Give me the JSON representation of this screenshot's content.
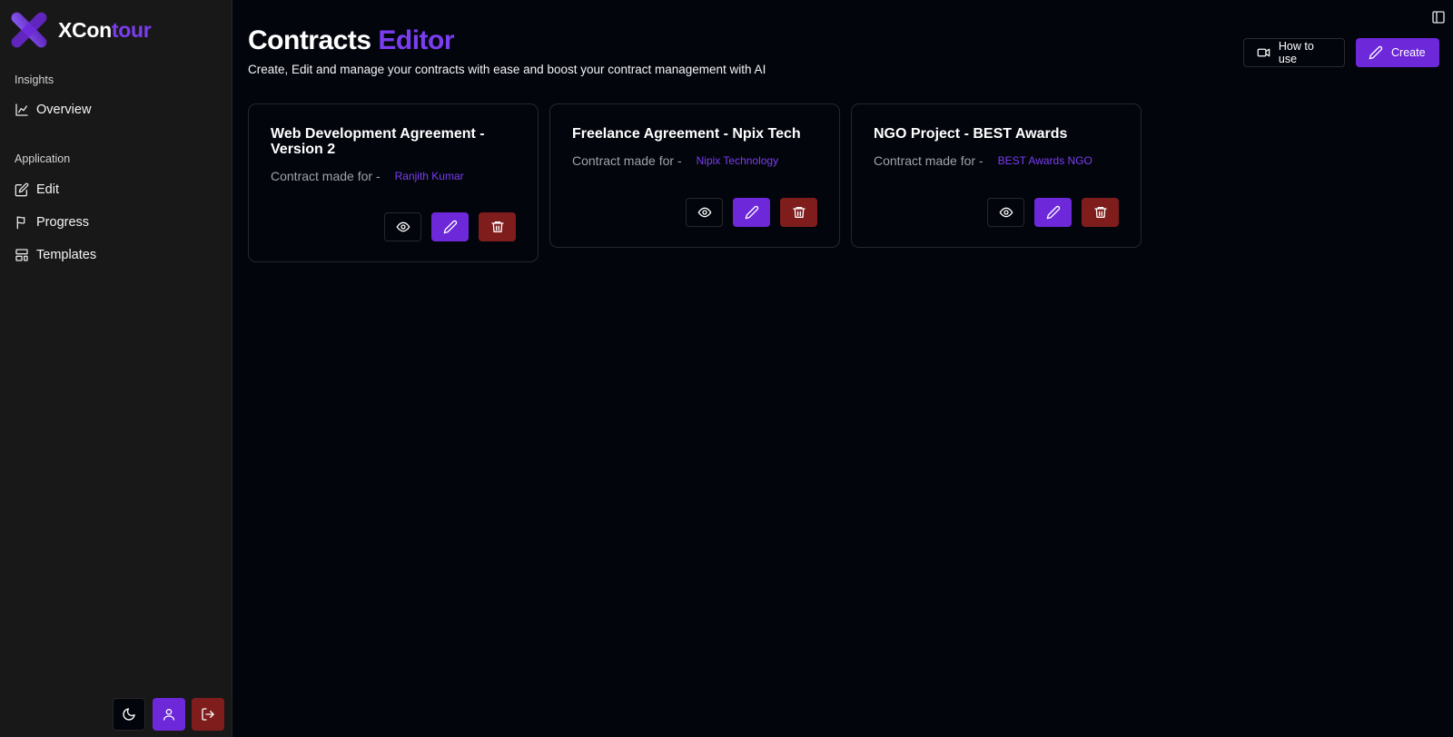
{
  "brand": {
    "name_part1": "XCon",
    "name_part2": "tour",
    "accent_color": "#7a3df0"
  },
  "sidebar": {
    "sections": [
      {
        "label": "Insights",
        "items": [
          {
            "label": "Overview",
            "icon": "chart-line-icon"
          }
        ]
      },
      {
        "label": "Application",
        "items": [
          {
            "label": "Edit",
            "icon": "edit-square-icon"
          },
          {
            "label": "Progress",
            "icon": "flag-icon"
          },
          {
            "label": "Templates",
            "icon": "layout-template-icon"
          }
        ]
      }
    ],
    "bottom_actions": [
      {
        "name": "theme-toggle",
        "icon": "moon-icon"
      },
      {
        "name": "profile",
        "icon": "user-icon"
      },
      {
        "name": "logout",
        "icon": "log-out-icon"
      }
    ]
  },
  "header": {
    "title_part1": "Contracts",
    "title_part2": "Editor",
    "subtitle": "Create, Edit and manage your contracts with ease and boost your contract management with AI",
    "how_to_use_label": "How to use",
    "create_label": "Create"
  },
  "contracts": [
    {
      "title": "Web Development Agreement - Version 2",
      "meta_label": "Contract made for -",
      "client": "Ranjith Kumar"
    },
    {
      "title": "Freelance Agreement - Npix Tech",
      "meta_label": "Contract made for -",
      "client": "Nipix Technology"
    },
    {
      "title": "NGO Project - BEST Awards",
      "meta_label": "Contract made for -",
      "client": "BEST Awards NGO"
    }
  ],
  "colors": {
    "primary": "#6d28d9",
    "danger": "#7f1d1d",
    "background": "#03050d",
    "sidebar": "#181818"
  }
}
